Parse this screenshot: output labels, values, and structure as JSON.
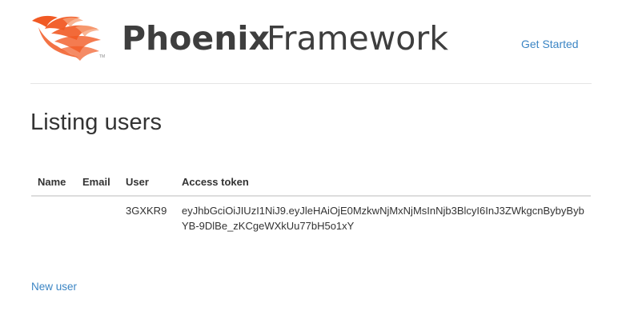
{
  "header": {
    "logo_bold": "Phoenix",
    "logo_light": "Framework",
    "get_started": "Get Started",
    "brand_color": "#f15a24",
    "logo_text_color": "#3e3e3e"
  },
  "main": {
    "title": "Listing users",
    "table": {
      "columns": [
        "Name",
        "Email",
        "User",
        "Access token"
      ],
      "rows": [
        {
          "name": "",
          "email": "",
          "user": "3GXKR9",
          "token_line1": "eyJhbGciOiJIUzI1NiJ9.eyJleHAiOjE0MzkwNjMxNjMsInNjb3BlcyI6InJ3ZWkgcnBybyByb",
          "token_line2": "YB-9DlBe_zKCgeWXkUu77bH5o1xY"
        }
      ]
    },
    "new_user_link": "New user"
  },
  "colors": {
    "link": "#3b85c4",
    "text": "#333333",
    "rule": "#e5e5e5"
  }
}
